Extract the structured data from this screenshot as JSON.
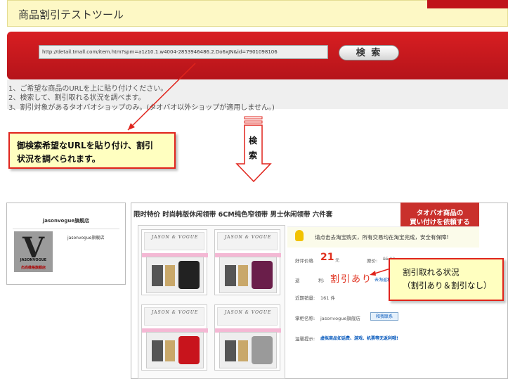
{
  "header": {
    "title": "商品割引テストツール"
  },
  "search": {
    "url_value": "http://detail.tmall.com/item.htm?spm=a1z10.1.w4004-2853946486.2.Do6xJN&id=7901098106",
    "button_label": "検 索"
  },
  "instructions": [
    "1、ご希望な商品のURLを上に貼り付けください。",
    "2、検索して、割引取れる状況を調べます。",
    "3、割引対象があるタオバオショップのみ。(タオバオ以外ショップが適用しません。)"
  ],
  "callout_search": {
    "line1": "御検索希望なURLを貼り付け、割引",
    "line2": "状況を調べられます。"
  },
  "arrow": {
    "label_1": "検",
    "label_2": "索"
  },
  "shop": {
    "name": "jasonvogue旗舰店",
    "logo_brand": "JASONVOGUE",
    "logo_sub": "杰尚维格旗舰店",
    "name_small": "jasonvogue旗舰店"
  },
  "product": {
    "title": "限时特价 时尚韩版休闲领带 6CM纯色窄领带 男士休闲领带 六件套",
    "ribbon_line1": "タオバオ商品の",
    "ribbon_line2": "買い付けを依頼する",
    "box_brand": "JASON & VOGUE",
    "tie_colors": [
      "#222222",
      "#6a1e4a",
      "#c8141c",
      "#9a9a9a"
    ],
    "notice": "请点击去淘宝购买，所有交易均在淘宝完成，安全有保障!",
    "promo_label": "好评价格",
    "price": "21",
    "yuan": "元",
    "orig_label": "原价:",
    "orig_price": "95.00",
    "orig_yuan": "元",
    "rebate_label_1": "返",
    "rebate_label_2": "利:",
    "discount_text": "割引あり",
    "discount_link": "去淘返利查",
    "sales_label": "近期销量:",
    "sales_value": "161 件",
    "shop_label": "掌柜名称:",
    "shop_value": "jasonvogue旗舰店",
    "contact_button": "和我联系",
    "link_label": "温馨提示:",
    "link_text": "虚拟商品如话费、游戏、机票等无返利哦!"
  },
  "callout_discount": {
    "line1": "割引取れる状況",
    "line2": "（割引あり＆割引なし）"
  }
}
